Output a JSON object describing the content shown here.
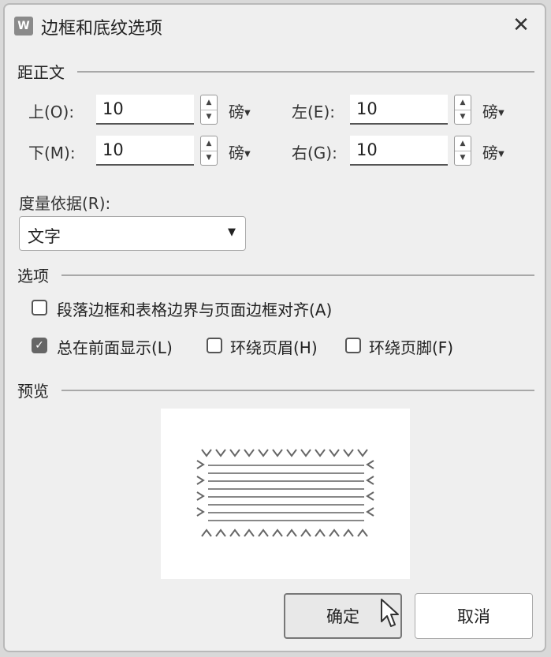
{
  "window": {
    "app_icon": "W",
    "title": "边框和底纹选项",
    "close_glyph": "✕"
  },
  "spacing": {
    "title": "距正文",
    "top": {
      "label": "上(O):",
      "value": "10",
      "unit": "磅"
    },
    "left": {
      "label": "左(E):",
      "value": "10",
      "unit": "磅"
    },
    "bottom": {
      "label": "下(M):",
      "value": "10",
      "unit": "磅"
    },
    "right": {
      "label": "右(G):",
      "value": "10",
      "unit": "磅"
    }
  },
  "measure": {
    "label": "度量依据(R):",
    "value": "文字"
  },
  "options": {
    "title": "选项",
    "align_border": {
      "label": "段落边框和表格边界与页面边框对齐(A)",
      "checked": false
    },
    "always_front": {
      "label": "总在前面显示(L)",
      "checked": true
    },
    "surround_header": {
      "label": "环绕页眉(H)",
      "checked": false
    },
    "surround_footer": {
      "label": "环绕页脚(F)",
      "checked": false
    }
  },
  "preview": {
    "title": "预览"
  },
  "buttons": {
    "ok": "确定",
    "cancel": "取消"
  },
  "icons": {
    "spin_up": "▲",
    "spin_down": "▼",
    "caret": "▼",
    "check": "✓",
    "cursor": "mouse-pointer-icon"
  }
}
